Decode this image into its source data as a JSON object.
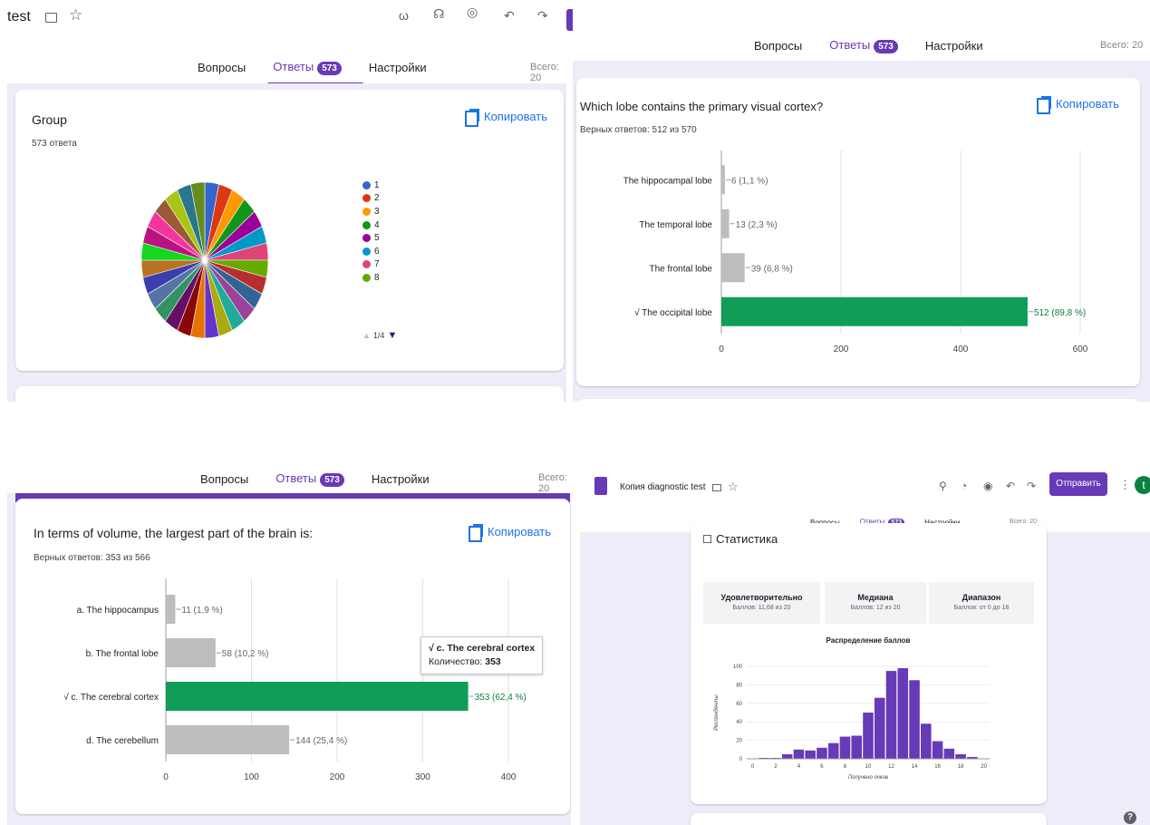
{
  "colors": {
    "accent": "#673ab7",
    "correct": "#0f9d58",
    "incorrect": "#bdbdbd",
    "link": "#1a73e8"
  },
  "topbar_tl": {
    "title": "test"
  },
  "tabs": {
    "questions": "Вопросы",
    "answers": "Ответы",
    "answers_count": "573",
    "settings": "Настройки"
  },
  "total_tl": "Всего: 20",
  "total_tr": "Всего: 20",
  "total_bl": "Всего: 20",
  "copy_label": "Копировать",
  "group_card": {
    "title": "Group",
    "subtitle": "573 ответа",
    "pager": "1/4"
  },
  "pie_legend": [
    {
      "label": "1",
      "color": "#3366cc"
    },
    {
      "label": "2",
      "color": "#dc3912"
    },
    {
      "label": "3",
      "color": "#ff9900"
    },
    {
      "label": "4",
      "color": "#109618"
    },
    {
      "label": "5",
      "color": "#990099"
    },
    {
      "label": "6",
      "color": "#0099c6"
    },
    {
      "label": "7",
      "color": "#dd4477"
    },
    {
      "label": "8",
      "color": "#66aa00"
    }
  ],
  "visual_card": {
    "title": "Which lobe contains the primary visual cortex?",
    "subtitle": "Верных ответов: 512 из 570"
  },
  "volume_card": {
    "title": "In terms of volume, the largest part of the brain is:",
    "subtitle": "Верных ответов: 353 из 566"
  },
  "tooltip": {
    "line1": "√ c. The cerebral cortex",
    "label": "Количество: ",
    "value": "353"
  },
  "br_header": {
    "title": "Копия diagnostic test",
    "send": "Отправить",
    "avatar": "t",
    "total": "Всего: 20"
  },
  "stats": {
    "heading": "Статистика",
    "boxes": [
      {
        "title": "Удовлетворительно",
        "value": "Баллов: 11,68 из 20"
      },
      {
        "title": "Медиана",
        "value": "Баллов: 12 из 20"
      },
      {
        "title": "Диапазон",
        "value": "Баллов: от 0 до 18"
      }
    ],
    "histogram_title": "Распределение баллов"
  },
  "chart_data": [
    {
      "type": "pie",
      "title": "",
      "segments": 28,
      "slices_color_sequence": [
        "#3366cc",
        "#dc3912",
        "#ff9900",
        "#109618",
        "#990099",
        "#0099c6",
        "#dd4477",
        "#66aa00",
        "#b82e2e",
        "#316395",
        "#994499",
        "#22aa99",
        "#aaaa11",
        "#6633cc",
        "#e67300",
        "#8b0707",
        "#651067",
        "#329262",
        "#5574a6",
        "#3b3eac",
        "#b77322",
        "#16d620",
        "#b91383",
        "#f4359e",
        "#9c5935",
        "#a9c413",
        "#2a778d",
        "#668d1c"
      ]
    },
    {
      "type": "bar",
      "orientation": "horizontal",
      "categories": [
        "The hippocampal lobe",
        "The temporal lobe",
        "The frontal lobe",
        "√ The occipital lobe"
      ],
      "values": [
        6,
        13,
        39,
        512
      ],
      "data_labels": [
        "6 (1,1 %)",
        "13 (2,3 %)",
        "39 (6,8 %)",
        "512 (89,8 %)"
      ],
      "correct_index": 3,
      "xlim": [
        0,
        600
      ],
      "xticks": [
        0,
        200,
        400,
        600
      ]
    },
    {
      "type": "bar",
      "orientation": "horizontal",
      "categories": [
        "a. The hippocampus",
        "b. The frontal lobe",
        "√ c. The cerebral cortex",
        "d. The cerebellum"
      ],
      "values": [
        11,
        58,
        353,
        144
      ],
      "data_labels": [
        "11 (1,9 %)",
        "58 (10,2 %)",
        "353 (62,4 %)",
        "144 (25,4 %)"
      ],
      "correct_index": 2,
      "xlim": [
        0,
        400
      ],
      "xticks": [
        0,
        100,
        200,
        300,
        400
      ]
    },
    {
      "type": "bar",
      "title": "Распределение баллов",
      "xlabel": "Получено очков",
      "ylabel": "Респонденты",
      "x": [
        0,
        1,
        2,
        3,
        4,
        5,
        6,
        7,
        8,
        9,
        10,
        11,
        12,
        13,
        14,
        15,
        16,
        17,
        18,
        19,
        20
      ],
      "values": [
        0,
        1,
        1,
        5,
        10,
        9,
        12,
        17,
        24,
        25,
        50,
        66,
        95,
        98,
        85,
        38,
        19,
        11,
        5,
        2,
        0
      ],
      "ylim": [
        0,
        100
      ],
      "yticks": [
        0,
        20,
        40,
        60,
        80,
        100
      ],
      "xticks": [
        0,
        2,
        4,
        6,
        8,
        10,
        12,
        14,
        16,
        18,
        20
      ]
    }
  ]
}
